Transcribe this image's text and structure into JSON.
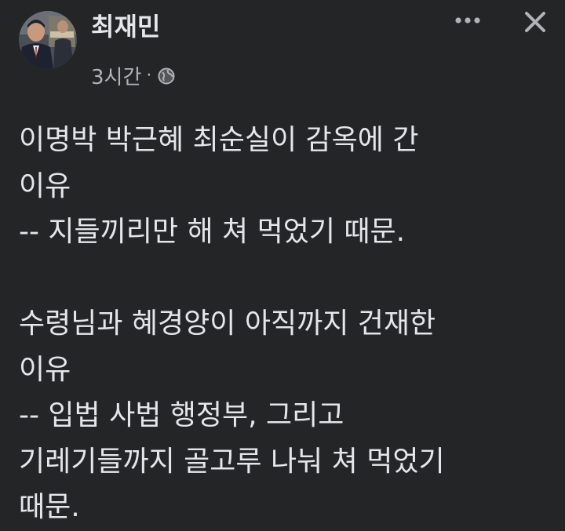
{
  "post": {
    "author": "최재민",
    "timestamp": "3시간",
    "separator": "·",
    "privacy_icon": "globe-icon",
    "more_icon": "more-horizontal-icon",
    "close_icon": "close-icon",
    "lines": [
      "이명박 박근혜 최순실이 감옥에 간",
      "이유",
      "-- 지들끼리만 해 쳐 먹었기 때문.",
      "",
      "수령님과 혜경양이 아직까지 건재한",
      "이유",
      "-- 입법 사법 행정부, 그리고",
      "기레기들까지 골고루 나눠 쳐 먹었기",
      "때문."
    ]
  },
  "colors": {
    "background": "#242526",
    "primary_text": "#e4e6eb",
    "secondary_text": "#b0b3b8"
  }
}
